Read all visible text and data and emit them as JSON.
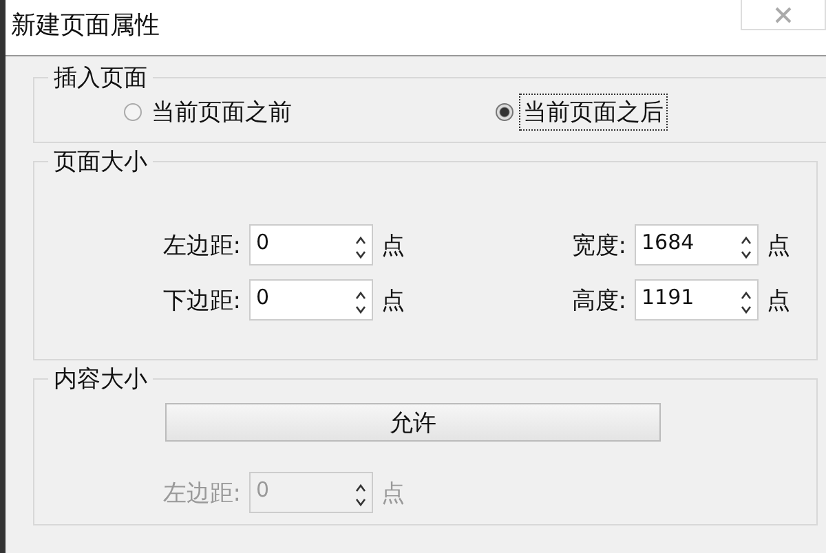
{
  "window": {
    "title": "新建页面属性"
  },
  "insert_page": {
    "title": "插入页面",
    "options": [
      {
        "label": "当前页面之前",
        "selected": false
      },
      {
        "label": "当前页面之后",
        "selected": true
      }
    ]
  },
  "page_size": {
    "title": "页面大小",
    "fields": [
      {
        "label": "左边距:",
        "value": "0",
        "unit": "点",
        "disabled": false
      },
      {
        "label": "宽度:",
        "value": "1684",
        "unit": "点",
        "disabled": false
      },
      {
        "label": "下边距:",
        "value": "0",
        "unit": "点",
        "disabled": false
      },
      {
        "label": "高度:",
        "value": "1191",
        "unit": "点",
        "disabled": false
      }
    ]
  },
  "content_size": {
    "title": "内容大小",
    "button": "允许",
    "fields": [
      {
        "label": "左边距:",
        "value": "0",
        "unit": "点",
        "disabled": true
      }
    ]
  }
}
